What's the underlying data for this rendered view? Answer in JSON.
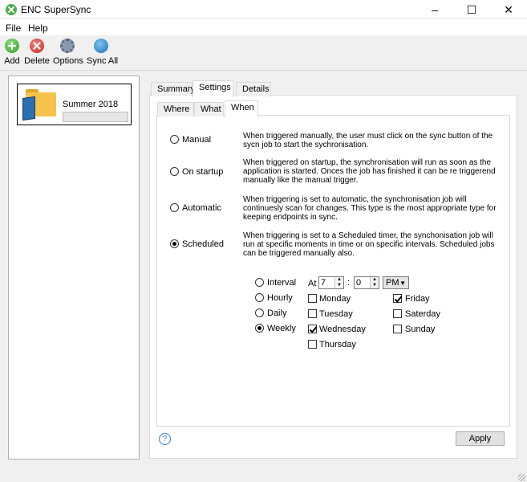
{
  "window": {
    "title": "ENC SuperSync"
  },
  "menu": [
    "File",
    "Help"
  ],
  "toolbar": {
    "add": "Add",
    "delete": "Delete",
    "options": "Options",
    "sync_all": "Sync All"
  },
  "jobs": [
    {
      "name": "Summer 2018",
      "progress": 0
    }
  ],
  "tabs": {
    "summary": "Summary",
    "settings": "Settings",
    "details": "Details",
    "active": "Settings"
  },
  "subtabs": {
    "where": "Where",
    "what": "What",
    "when": "When",
    "active": "When"
  },
  "trigger": {
    "selected": "Scheduled",
    "options": [
      {
        "label": "Manual",
        "description": "When triggered manually, the user must click on the sync button of the sycn job to start the sychronisation."
      },
      {
        "label": "On startup",
        "description": "When triggered on startup, the synchronisation will run as soon as the application is started. Onces the job has finished it can be re triggerend manually like the manual trigger."
      },
      {
        "label": "Automatic",
        "description": "When triggering is set to automatic, the synchronisation job will continuesly scan for changes. This type is the most appropriate type for keeping endpoints in sync."
      },
      {
        "label": "Scheduled",
        "description": "When triggering is set to a Scheduled timer, the synchonisation job will run at specific moments in time or on specific intervals. Scheduled jobs can be triggered manually also."
      }
    ]
  },
  "schedule": {
    "frequency_selected": "Weekly",
    "frequencies": [
      "Interval",
      "Hourly",
      "Daily",
      "Weekly"
    ],
    "at_label": "At",
    "hour": "7",
    "separator": ":",
    "minute": "0",
    "ampm": "PM",
    "days": [
      {
        "label": "Monday",
        "checked": false
      },
      {
        "label": "Tuesday",
        "checked": false
      },
      {
        "label": "Wednesday",
        "checked": true
      },
      {
        "label": "Thursday",
        "checked": false
      },
      {
        "label": "Friday",
        "checked": true
      },
      {
        "label": "Saterday",
        "checked": false
      },
      {
        "label": "Sunday",
        "checked": false
      }
    ]
  },
  "buttons": {
    "help": "?",
    "apply": "Apply"
  },
  "icons": [
    "app-icon",
    "add-icon",
    "delete-icon",
    "options-icon",
    "sync-all-icon",
    "folder-icon",
    "help-icon"
  ]
}
